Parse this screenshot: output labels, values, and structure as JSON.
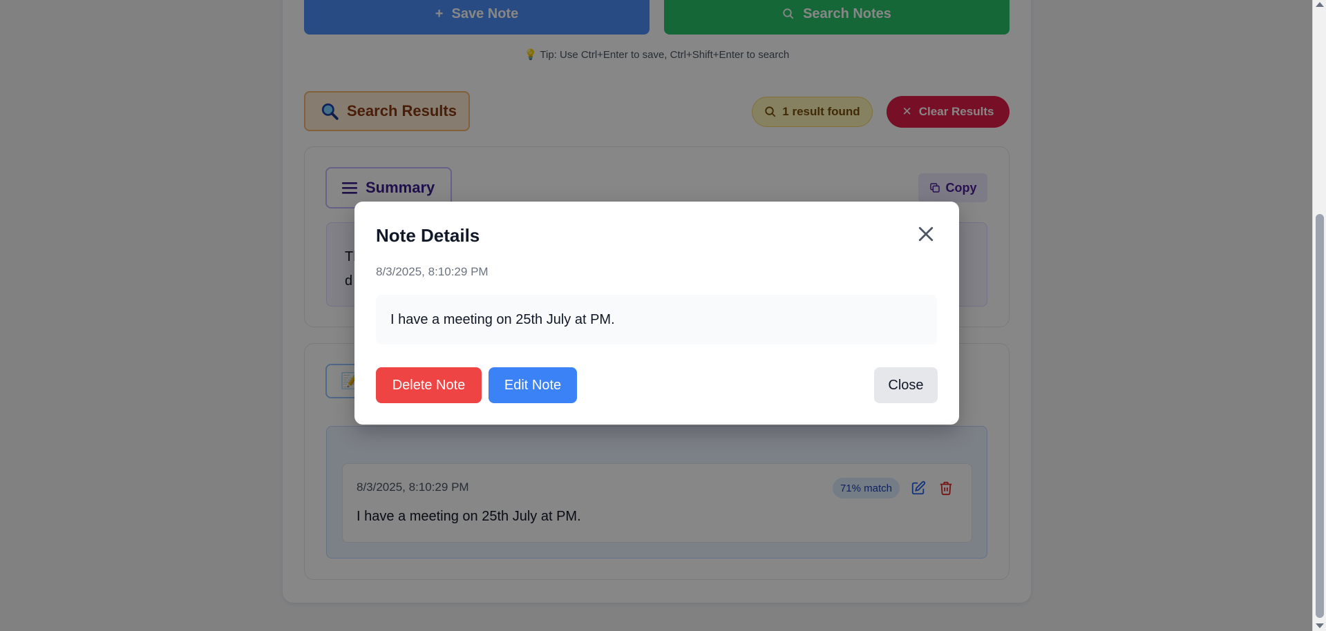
{
  "toolbar": {
    "save_label": "Save Note",
    "save_icon": "plus-icon",
    "search_label": "Search Notes",
    "search_icon": "search-icon",
    "tip": "Tip: Use Ctrl+Enter to save, Ctrl+Shift+Enter to search"
  },
  "results": {
    "title": "Search Results",
    "count_label": "1 result found",
    "clear_label": "Clear Results"
  },
  "summary": {
    "title": "Summary",
    "copy_label": "Copy",
    "text_line1": "Th",
    "text_line2": "d"
  },
  "notes": {
    "items": [
      {
        "timestamp": "8/3/2025, 8:10:29 PM",
        "text": "I have a meeting on 25th July at PM.",
        "match": "71% match"
      }
    ]
  },
  "modal": {
    "title": "Note Details",
    "timestamp": "8/3/2025, 8:10:29 PM",
    "body": "I have a meeting on 25th July at PM.",
    "delete_label": "Delete Note",
    "edit_label": "Edit Note",
    "close_label": "Close"
  },
  "colors": {
    "save": "#4f8ff7",
    "search": "#28c26b",
    "clear": "#e11d48",
    "delete": "#ef4444",
    "edit": "#3b82f6"
  }
}
